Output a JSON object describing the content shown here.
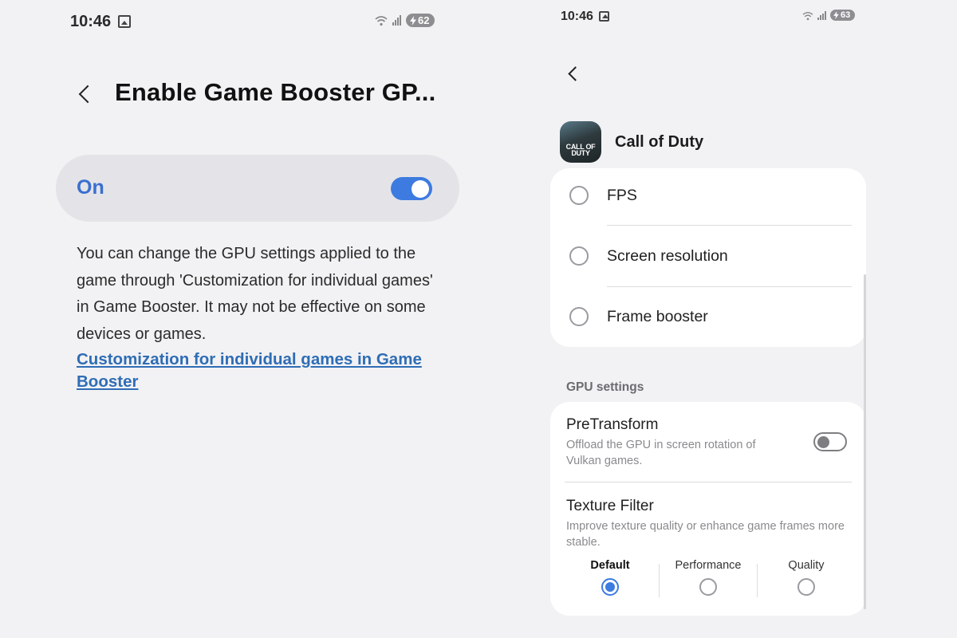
{
  "left_screen": {
    "status_bar": {
      "time": "10:46",
      "battery": "62"
    },
    "header": {
      "title": "Enable Game Booster GP..."
    },
    "main_toggle": {
      "label": "On",
      "enabled": true
    },
    "description": "You can change the GPU settings applied to the game through 'Customization for individual games' in Game Booster. It may not be effective on some devices or games.",
    "link": "Customization for individual games in Game Booster"
  },
  "right_screen": {
    "status_bar": {
      "time": "10:46",
      "battery": "63"
    },
    "app": {
      "name": "Call of Duty",
      "icon_text": "CALL OF DUTY"
    },
    "priority_options": [
      {
        "label": "FPS",
        "selected": false
      },
      {
        "label": "Screen resolution",
        "selected": false
      },
      {
        "label": "Frame booster",
        "selected": false
      }
    ],
    "gpu_section": {
      "header": "GPU settings",
      "pretransform": {
        "title": "PreTransform",
        "description": "Offload the GPU in screen rotation of Vulkan games.",
        "enabled": false
      },
      "texture_filter": {
        "title": "Texture Filter",
        "description": "Improve texture quality or enhance game frames more stable.",
        "options": [
          {
            "label": "Default",
            "selected": true
          },
          {
            "label": "Performance",
            "selected": false
          },
          {
            "label": "Quality",
            "selected": false
          }
        ]
      }
    }
  },
  "colors": {
    "accent": "#3d7be0",
    "link": "#2f6db5",
    "background": "#f2f2f4",
    "card": "#ffffff"
  }
}
